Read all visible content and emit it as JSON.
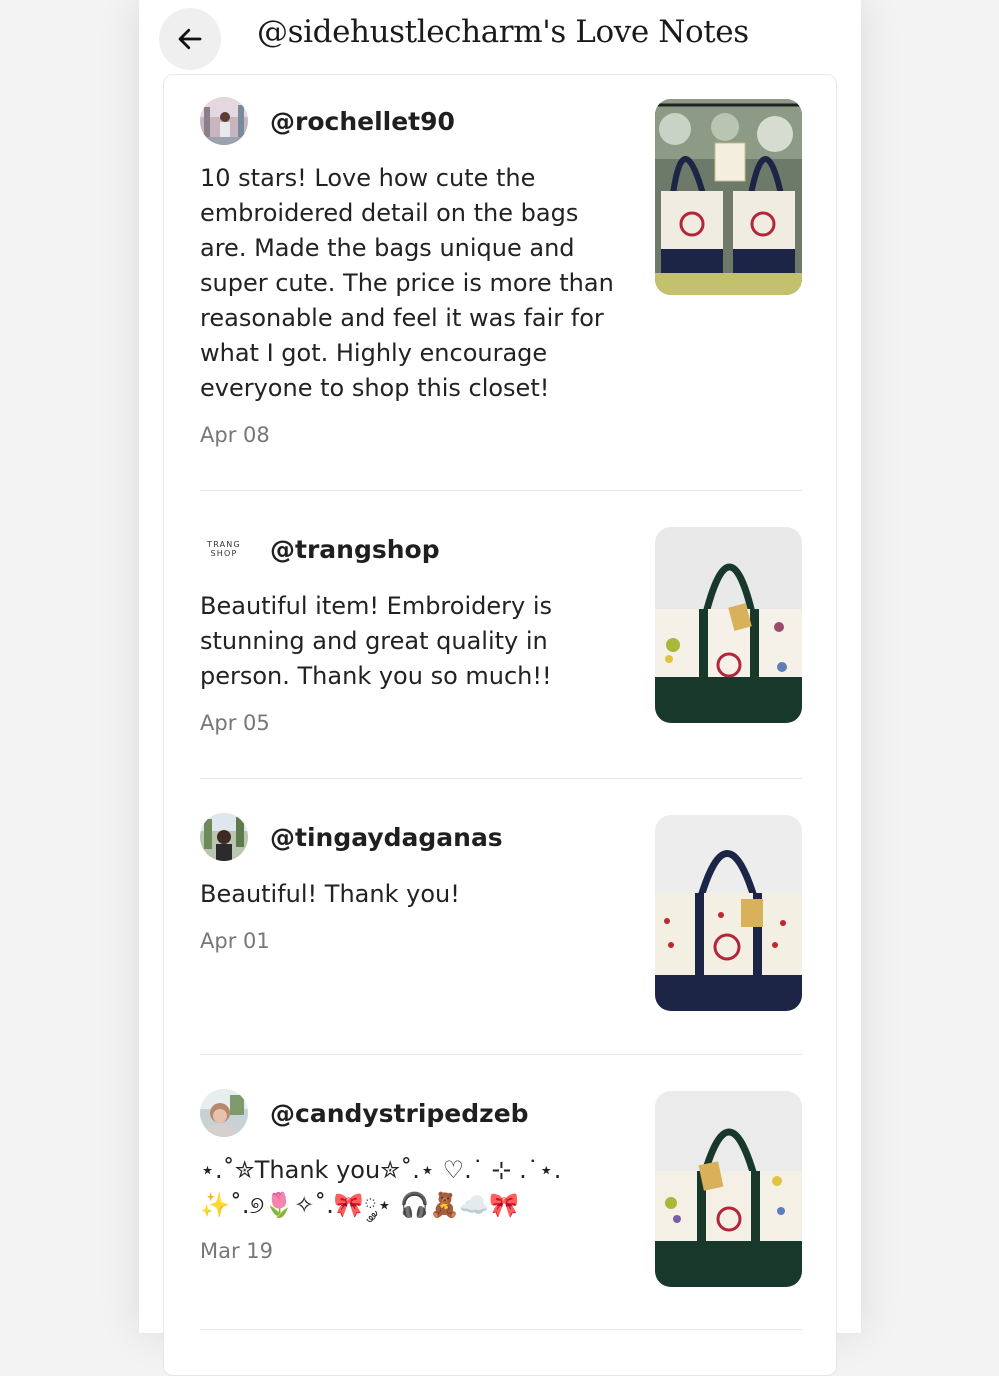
{
  "header": {
    "title": "@sidehustlecharm's Love Notes",
    "back_icon": "arrow-left-icon"
  },
  "notes": [
    {
      "username": "@rochellet90",
      "text": "10 stars! Love how cute the embroidered detail on the bags are. Made the bags unique and super cute. The price is more than reasonable and feel it was fair for what I got. Highly encourage everyone to shop this closet!",
      "date": "Apr 08"
    },
    {
      "username": "@trangshop",
      "avatar_text_1": "TRANG",
      "avatar_text_2": "SHOP",
      "text": "Beautiful item! Embroidery is stunning and great quality in person. Thank you so much!!",
      "date": "Apr 05"
    },
    {
      "username": "@tingaydaganas",
      "text": "Beautiful! Thank you!",
      "date": "Apr 01"
    },
    {
      "username": "@candystripedzeb",
      "text_line1": "⋆.˚✮Thank you✮˚.⋆ ♡.˙ ⊹ .˙⋆.",
      "text_line2": "✨˚.୭🌷✧˚.🎀༘⋆ 🎧🧸☁️🎀",
      "date": "Mar 19"
    }
  ],
  "colors": {
    "accent_red": "#b3263a",
    "navy_handle": "#1c2545",
    "green_handle": "#17382a"
  }
}
